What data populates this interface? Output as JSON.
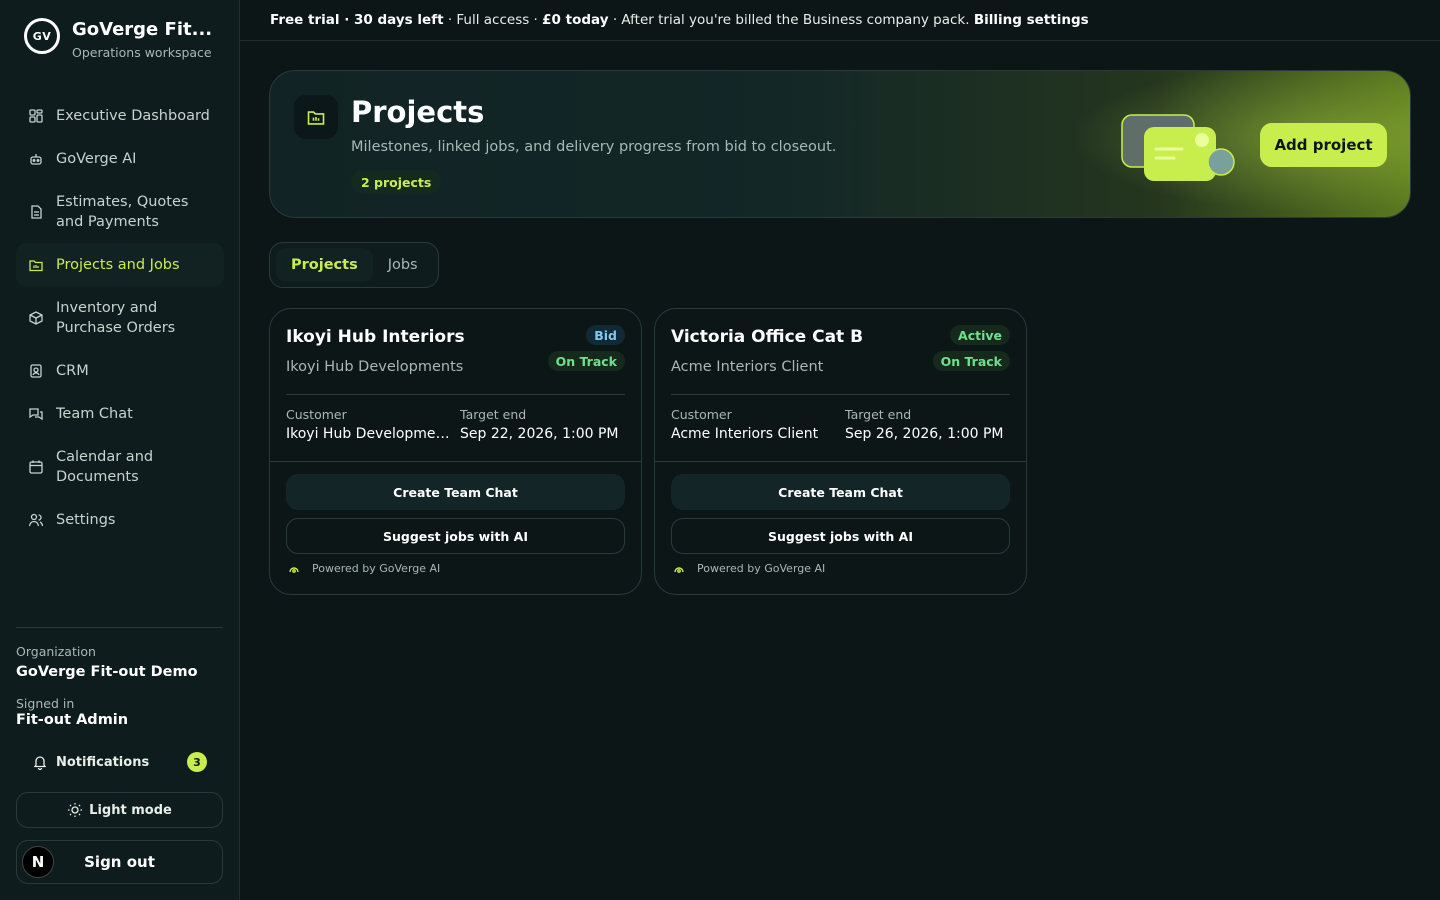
{
  "brand": {
    "logo_text": "GV",
    "name": "GoVerge Fit...",
    "subtitle": "Operations workspace"
  },
  "nav": [
    {
      "label": "Executive Dashboard",
      "icon": "dashboard-icon"
    },
    {
      "label": "GoVerge AI",
      "icon": "robot-icon"
    },
    {
      "label": "Estimates, Quotes and Payments",
      "icon": "document-icon"
    },
    {
      "label": "Projects and Jobs",
      "icon": "folder-icon",
      "active": true
    },
    {
      "label": "Inventory and Purchase Orders",
      "icon": "box-icon"
    },
    {
      "label": "CRM",
      "icon": "contact-icon"
    },
    {
      "label": "Team Chat",
      "icon": "chat-icon"
    },
    {
      "label": "Calendar and Documents",
      "icon": "calendar-icon"
    },
    {
      "label": "Settings",
      "icon": "users-icon"
    }
  ],
  "org": {
    "label": "Organization",
    "name": "GoVerge Fit-out Demo"
  },
  "signed": {
    "label": "Signed in",
    "name": "Fit-out Admin"
  },
  "notifications": {
    "label": "Notifications",
    "count": "3"
  },
  "light_mode_label": "Light mode",
  "signout": {
    "avatar": "N",
    "label": "Sign out"
  },
  "topbar": {
    "trial": "Free trial · 30 days left",
    "access": " · Full access · ",
    "today": "£0 today",
    "billing_note": " · After trial you're billed the Business company pack. ",
    "billing_link": "Billing settings"
  },
  "hero": {
    "title": "Projects",
    "subtitle": "Milestones, linked jobs, and delivery progress from bid to closeout.",
    "count_badge": "2 projects",
    "add_button": "Add project"
  },
  "tabs": [
    {
      "label": "Projects",
      "active": true
    },
    {
      "label": "Jobs"
    }
  ],
  "projects": [
    {
      "title": "Ikoyi Hub Interiors",
      "client": "Ikoyi Hub Developments",
      "stage": "Bid",
      "health": "On Track",
      "customer_label": "Customer",
      "customer": "Ikoyi Hub Developments",
      "target_label": "Target end",
      "target": "Sep 22, 2026, 1:00 PM",
      "chat_button": "Create Team Chat",
      "suggest_button": "Suggest jobs with AI",
      "powered": "Powered by GoVerge AI"
    },
    {
      "title": "Victoria Office Cat B",
      "client": "Acme Interiors Client",
      "stage": "Active",
      "health": "On Track",
      "customer_label": "Customer",
      "customer": "Acme Interiors Client",
      "target_label": "Target end",
      "target": "Sep 26, 2026, 1:00 PM",
      "chat_button": "Create Team Chat",
      "suggest_button": "Suggest jobs with AI",
      "powered": "Powered by GoVerge AI"
    }
  ],
  "colors": {
    "accent": "#c8ee4e",
    "background": "#0c1617",
    "sidebar": "#0f1c1d"
  }
}
